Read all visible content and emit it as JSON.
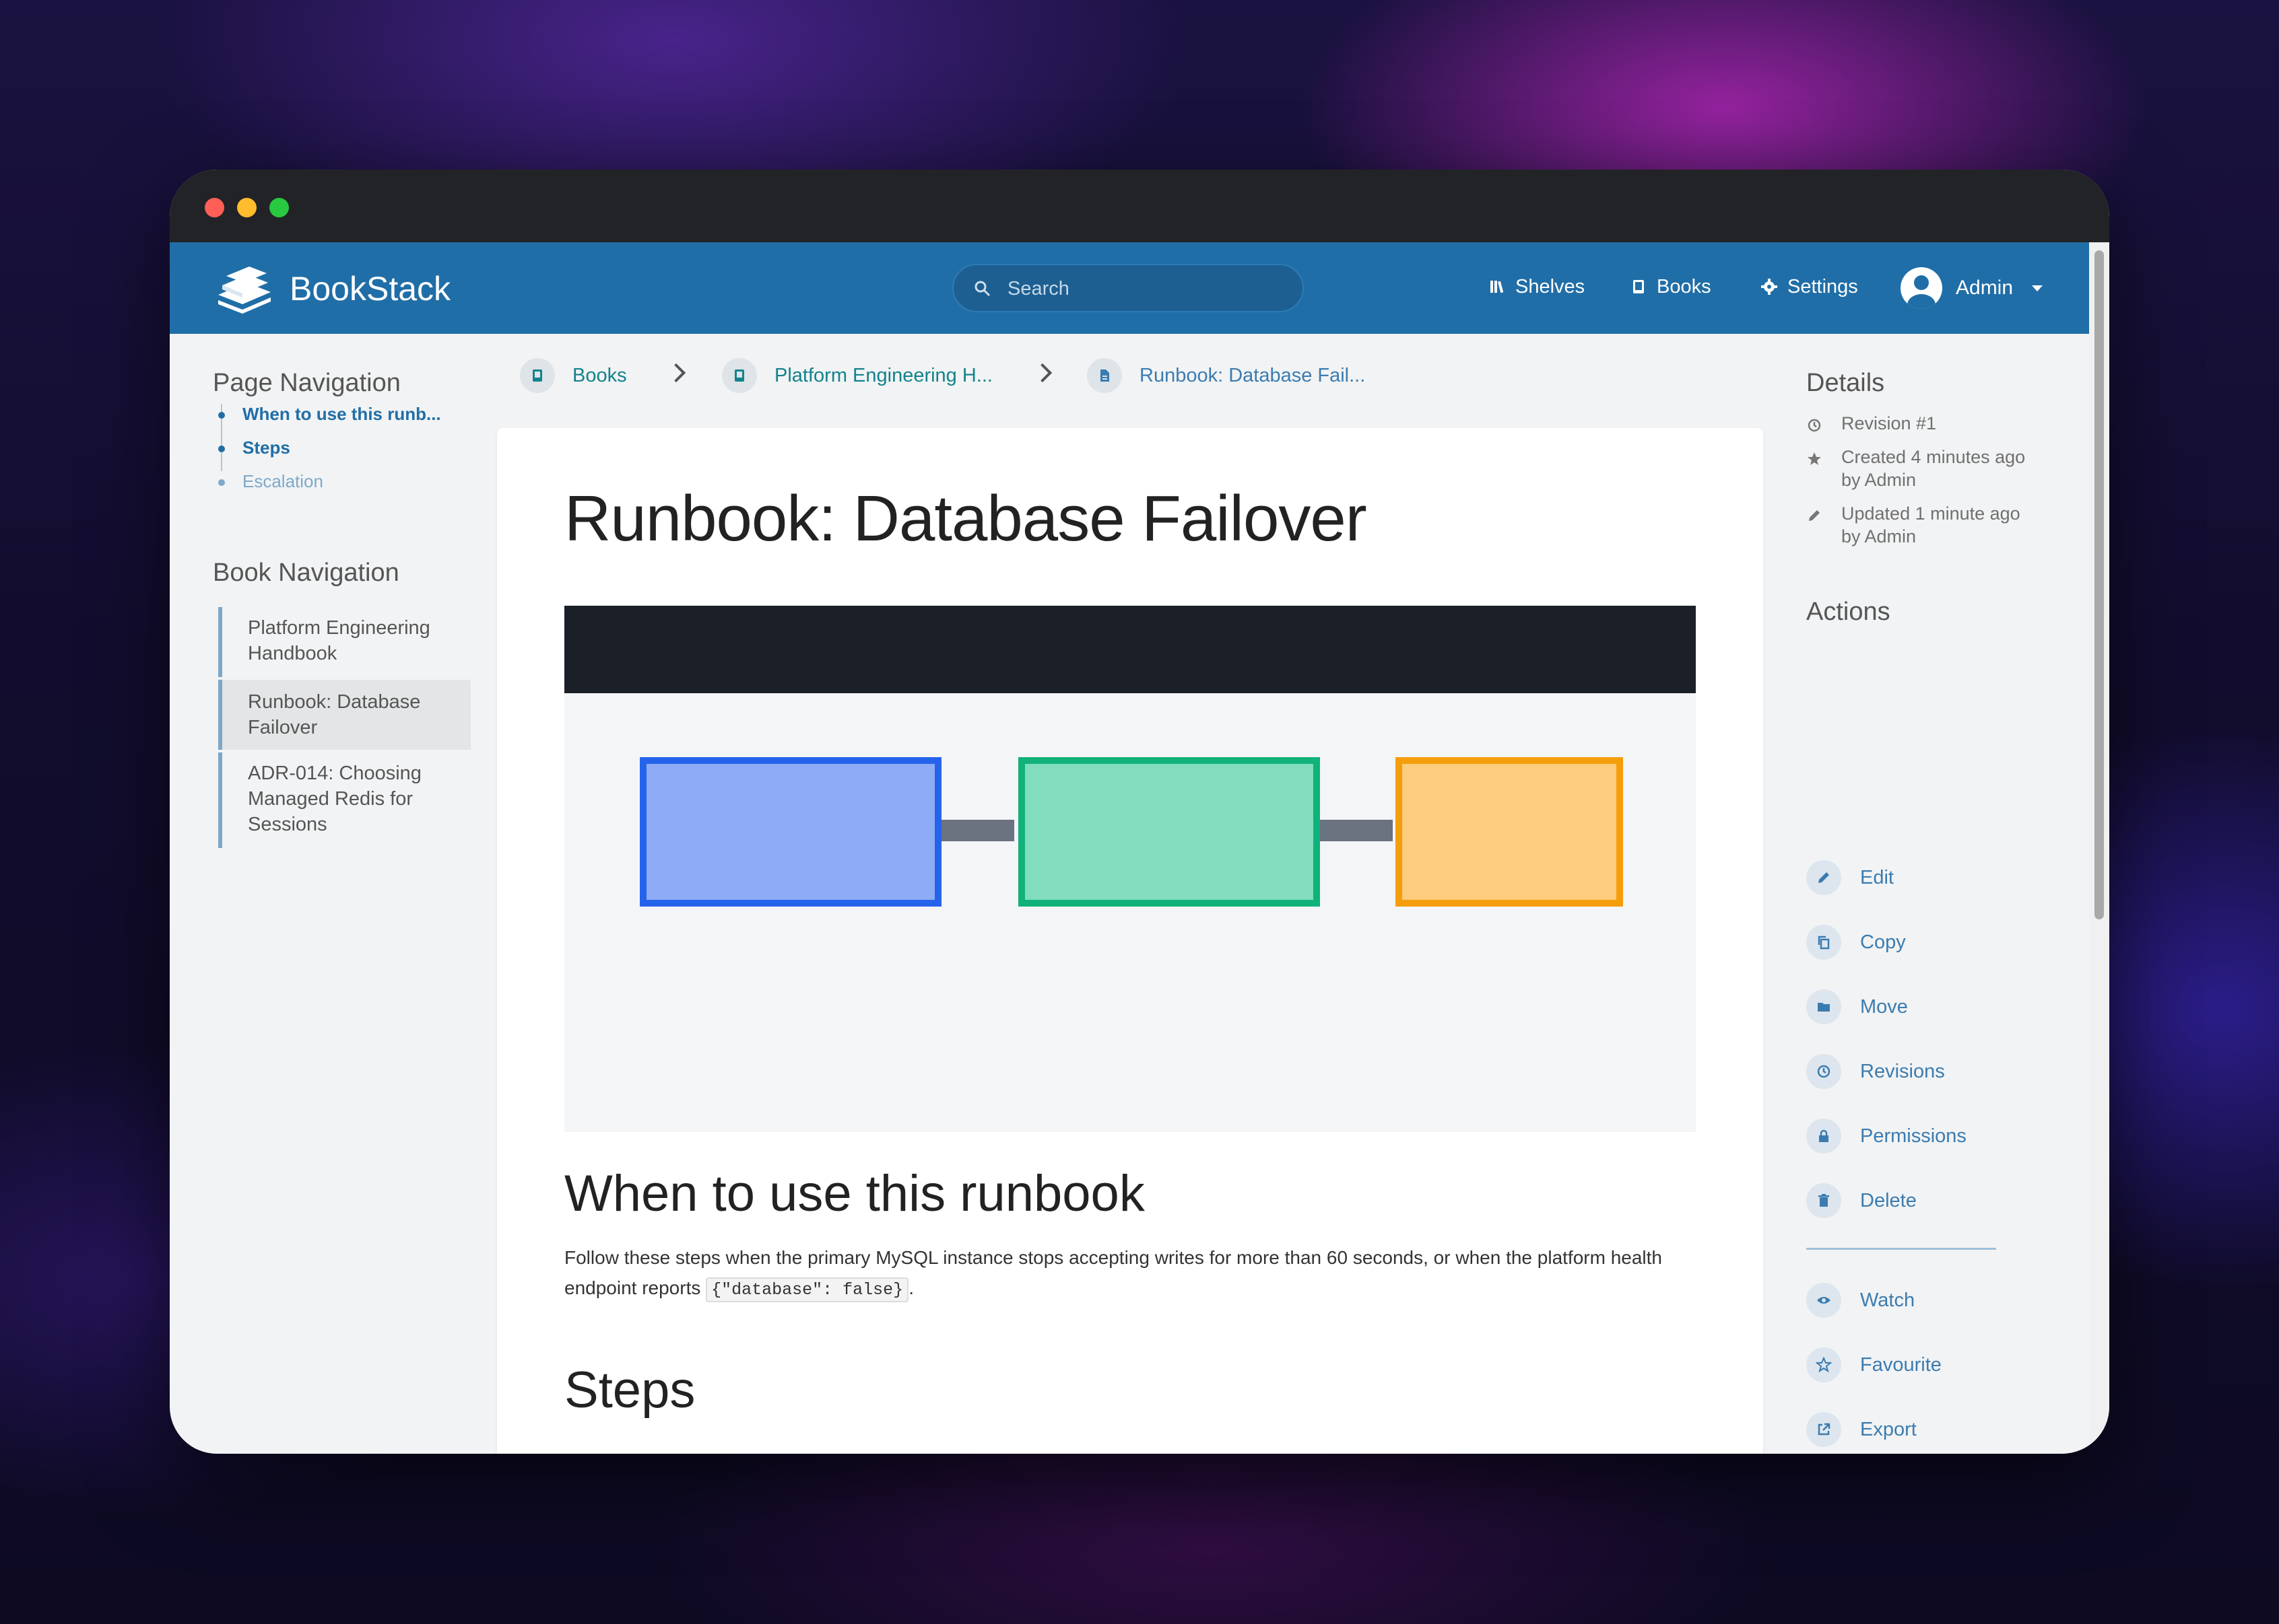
{
  "app": {
    "name": "BookStack"
  },
  "header": {
    "search_placeholder": "Search",
    "nav": {
      "shelves": "Shelves",
      "books": "Books",
      "settings": "Settings"
    },
    "user": {
      "name": "Admin"
    }
  },
  "breadcrumbs": [
    "Books",
    "Platform Engineering H...",
    "Runbook: Database Fail..."
  ],
  "page_navigation": {
    "title": "Page Navigation",
    "items": [
      "When to use this runb...",
      "Steps",
      "Escalation"
    ]
  },
  "book_navigation": {
    "title": "Book Navigation",
    "items": [
      {
        "label": "Platform Engineering Handbook"
      },
      {
        "label": "Runbook: Database Failover",
        "active": true
      },
      {
        "label": "ADR-014: Choosing Managed Redis for Sessions"
      }
    ]
  },
  "page": {
    "title": "Runbook: Database Failover",
    "diagram": {
      "colors": {
        "box1_fill": "#8eacf5",
        "box1_border": "#2563eb",
        "box2_fill": "#81ddbe",
        "box2_border": "#10b27a",
        "box3_fill": "#fdcc7c",
        "box3_border": "#f59e0b",
        "connector": "#6b7280",
        "topbar": "#1b1f27"
      }
    },
    "section1_title": "When to use this runbook",
    "section1_text_before": "Follow these steps when the primary MySQL instance stops accepting writes for more than 60 seconds, or when the platform health endpoint reports ",
    "section1_code": "{\"database\": false}",
    "section1_text_after": ".",
    "section2_title": "Steps"
  },
  "details": {
    "title": "Details",
    "revision": "Revision #1",
    "created_line1": "Created 4 minutes ago",
    "created_line2": "by Admin",
    "updated_line1": "Updated 1 minute ago",
    "updated_line2": "by Admin"
  },
  "actions": {
    "title": "Actions",
    "edit": "Edit",
    "copy": "Copy",
    "move": "Move",
    "revisions": "Revisions",
    "permissions": "Permissions",
    "delete": "Delete",
    "watch": "Watch",
    "favourite": "Favourite",
    "export": "Export"
  },
  "colors": {
    "header": "#206ea7",
    "accent_link": "#206ea7",
    "breadcrumb_link": "#12838c",
    "action_link": "#3b7cb0"
  }
}
